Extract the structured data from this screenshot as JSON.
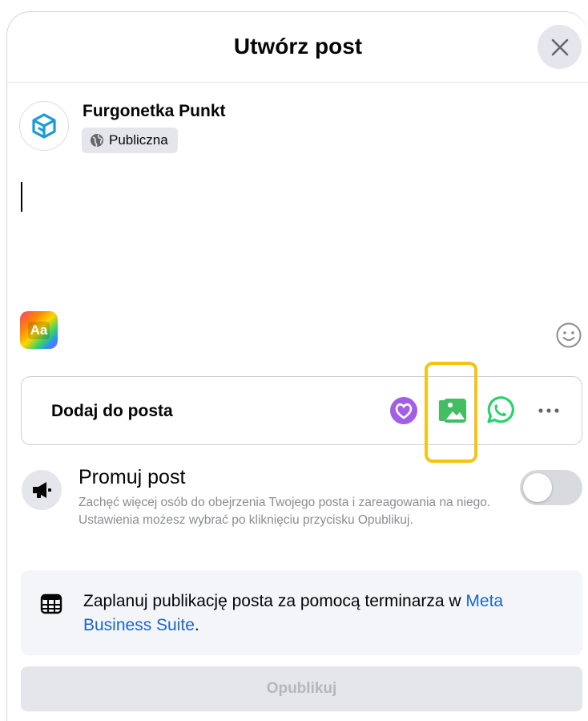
{
  "dialog": {
    "title": "Utwórz post"
  },
  "author": {
    "name": "Furgonetka Punkt",
    "audience": "Publiczna"
  },
  "composer": {
    "text": ""
  },
  "add_to_post": {
    "label": "Dodaj do posta",
    "tools": [
      "avatar-heart-icon",
      "photo-video-icon",
      "whatsapp-icon",
      "more-icon"
    ]
  },
  "promote": {
    "title": "Promuj post",
    "description": "Zachęć więcej osób do obejrzenia Twojego posta i zareagowania na niego. Ustawienia możesz wybrać po kliknięciu przycisku Opublikuj.",
    "enabled": false
  },
  "schedule": {
    "text": "Zaplanuj publikację posta za pomocą terminarza w ",
    "link": "Meta Business Suite",
    "suffix": "."
  },
  "publish": {
    "label": "Opublikuj"
  },
  "colors": {
    "link": "#1c66c9",
    "highlight": "#f4c316",
    "photo": "#45bd62",
    "avatar_heart": "#a35ee6",
    "whatsapp": "#25d366"
  }
}
